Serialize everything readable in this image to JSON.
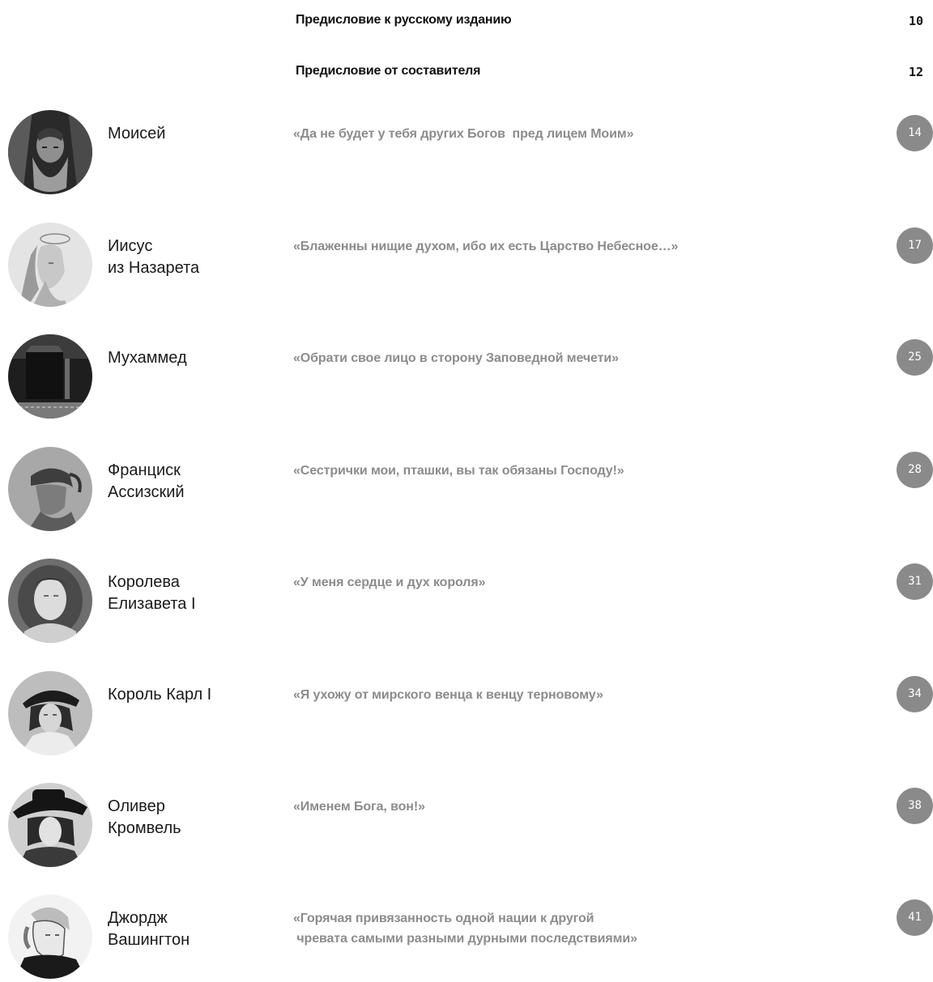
{
  "front_matter": [
    {
      "title": "Предисловие к русскому изданию",
      "page": "10"
    },
    {
      "title": "Предисловие от составителя",
      "page": "12"
    }
  ],
  "entries": [
    {
      "name_lines": [
        "Моисей"
      ],
      "quote_lines": [
        "«Да не будет у тебя других Богов  пред лицем Моим»"
      ],
      "page": "14"
    },
    {
      "name_lines": [
        "Иисус",
        "из Назарета"
      ],
      "quote_lines": [
        "«Блаженны нищие духом, ибо их есть Царство Небесное…»"
      ],
      "page": "17"
    },
    {
      "name_lines": [
        "Мухаммед"
      ],
      "quote_lines": [
        "«Обрати свое лицо в сторону Заповедной мечети»"
      ],
      "page": "25"
    },
    {
      "name_lines": [
        "Франциск",
        "Ассизский"
      ],
      "quote_lines": [
        "«Сестрички мои, пташки, вы так обязаны Господу!»"
      ],
      "page": "28"
    },
    {
      "name_lines": [
        "Королева",
        "Елизавета I"
      ],
      "quote_lines": [
        "«У меня сердце и дух короля»"
      ],
      "page": "31"
    },
    {
      "name_lines": [
        "Король Карл I"
      ],
      "quote_lines": [
        "«Я ухожу от мирского венца к венцу терновому»"
      ],
      "page": "34"
    },
    {
      "name_lines": [
        "Оливер",
        "Кромвель"
      ],
      "quote_lines": [
        "«Именем Бога, вон!»"
      ],
      "page": "38"
    },
    {
      "name_lines": [
        "Джордж",
        "Вашингтон"
      ],
      "quote_lines": [
        "«Горячая привязанность одной нации к другой",
        " чревата самыми разными дурными последствиями»"
      ],
      "page": "41"
    }
  ]
}
